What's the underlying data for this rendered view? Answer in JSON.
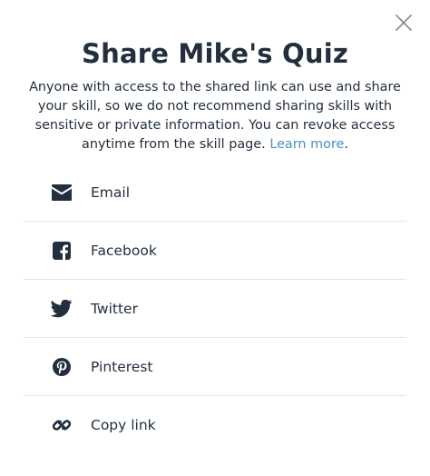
{
  "dialog": {
    "title": "Share Mike's Quiz",
    "description": "Anyone with access to the shared link can use and share your skill, so we do not recommend sharing skills with sensitive or private information. You can revoke access anytime from the skill page. ",
    "learn_more": "Learn more",
    "description_end": ".",
    "close_icon": "close-icon"
  },
  "share_options": [
    {
      "label": "Email",
      "icon": "envelope-icon"
    },
    {
      "label": "Facebook",
      "icon": "facebook-icon"
    },
    {
      "label": "Twitter",
      "icon": "twitter-icon"
    },
    {
      "label": "Pinterest",
      "icon": "pinterest-icon"
    },
    {
      "label": "Copy link",
      "icon": "link-icon"
    }
  ],
  "colors": {
    "text": "#232f3e",
    "link": "#4a90c2",
    "divider": "#e6e6e6",
    "close": "#8a8f96"
  }
}
